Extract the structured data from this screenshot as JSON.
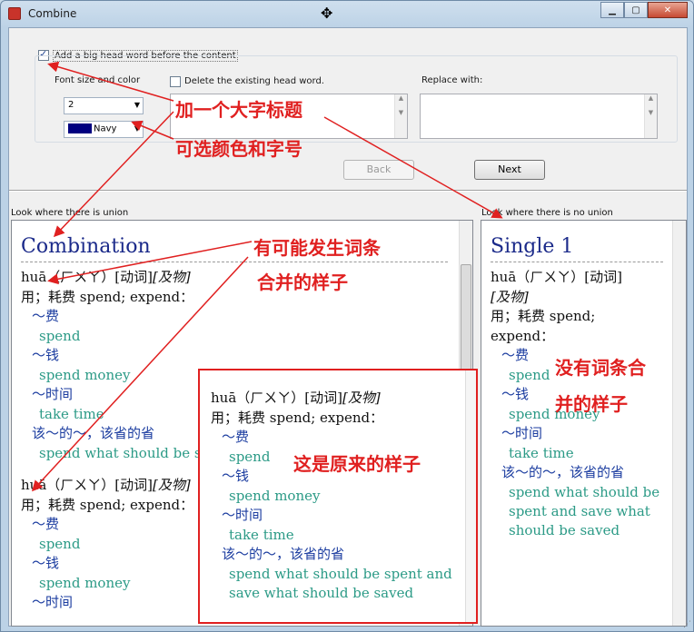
{
  "window": {
    "title": "Combine"
  },
  "options": {
    "add_head_label": "Add a big head word before the content",
    "add_head_checked": true,
    "font_label": "Font size and color",
    "size_value": "2",
    "color_value": "Navy",
    "color_hex": "#000080",
    "delete_head_label": "Delete the existing head word.",
    "delete_head_checked": false,
    "replace_label": "Replace with:"
  },
  "buttons": {
    "back": "Back",
    "next": "Next"
  },
  "left_pane": {
    "label": "Look where there is union",
    "headword": "Combination",
    "entries": [
      {
        "pron": "huā（ㄏㄨㄚ）[动词]",
        "pos": "[及物]",
        "def": "用；耗费  spend; expend：",
        "items": [
          {
            "cn": "～费",
            "ex": "spend"
          },
          {
            "cn": "～钱",
            "ex": "spend money"
          },
          {
            "cn": "～时间",
            "ex": "take time"
          },
          {
            "cn": "该～的～，该省的省",
            "ex": "spend what should be spent and save what should be saved"
          }
        ]
      },
      {
        "pron": "huā（ㄏㄨㄚ）[动词]",
        "pos": "[及物]",
        "def": "用；耗费  spend; expend：",
        "items": [
          {
            "cn": "～费",
            "ex": "spend"
          },
          {
            "cn": "～钱",
            "ex": "spend money"
          },
          {
            "cn": "～时间",
            "ex": ""
          }
        ]
      }
    ]
  },
  "right_pane": {
    "label": "Look where there is no union",
    "headword": "Single 1",
    "pron": "huā（ㄏㄨㄚ）[动词]",
    "pos": "[及物]",
    "def1": "用；耗费  spend;",
    "def2": "expend：",
    "items": [
      {
        "cn": "～费",
        "ex": "spend"
      },
      {
        "cn": "～钱",
        "ex": "spend money"
      },
      {
        "cn": "～时间",
        "ex": "take time"
      },
      {
        "cn": "该～的～，该省的省",
        "ex": "spend what should be spent and save what should be saved"
      }
    ]
  },
  "popup": {
    "pron": "huā（ㄏㄨㄚ）[动词]",
    "pos": "[及物]",
    "def": "用；耗费  spend; expend：",
    "items": [
      {
        "cn": "～费",
        "ex": "spend"
      },
      {
        "cn": "～钱",
        "ex": "spend money"
      },
      {
        "cn": "～时间",
        "ex": "take time"
      },
      {
        "cn": "该～的～，该省的省",
        "ex": "spend what should be spent and save what should be saved"
      }
    ]
  },
  "annotations": {
    "big_head": "加一个大字标题",
    "color_size": "可选颜色和字号",
    "merge_1": "有可能发生词条",
    "merge_2": "合并的样子",
    "no_merge_1": "没有词条合",
    "no_merge_2": "并的样子",
    "original": "这是原来的样子"
  }
}
